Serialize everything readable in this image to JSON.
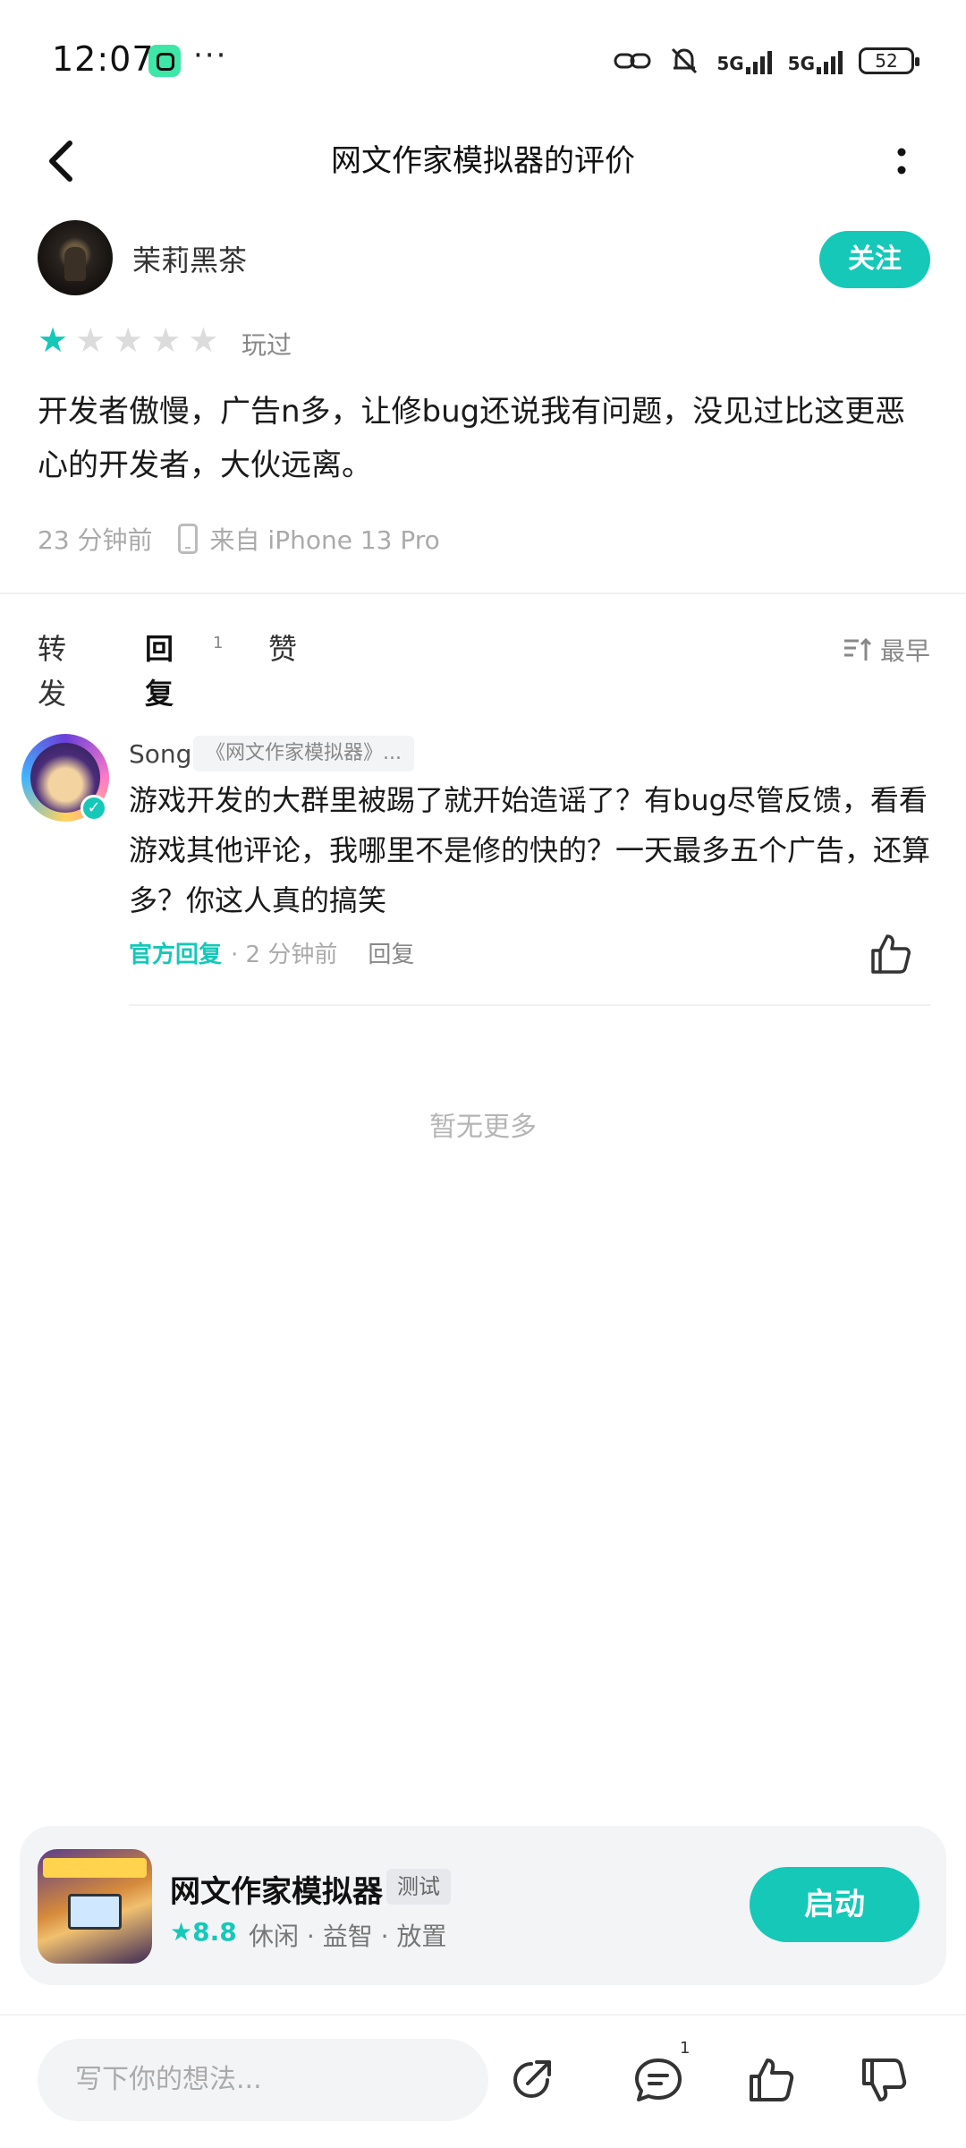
{
  "status_bar": {
    "time": "12:07",
    "dots": "···",
    "net1": "5G",
    "net2": "5G",
    "battery": "52"
  },
  "header": {
    "title": "网文作家模拟器的评价"
  },
  "review": {
    "author": "茉莉黑茶",
    "follow_label": "关注",
    "rating": 1,
    "max_rating": 5,
    "status": "玩过",
    "text": "开发者傲慢，广告n多，让修bug还说我有问题，没见过比这更恶心的开发者，大伙远离。",
    "time": "23 分钟前",
    "device": "来自 iPhone 13 Pro"
  },
  "tabs": {
    "forward": "转发",
    "reply": "回复",
    "reply_count": "1",
    "like": "赞",
    "sort": "最早"
  },
  "reply": {
    "name": "Song",
    "tag": "《网文作家模拟器》...",
    "text": "游戏开发的大群里被踢了就开始造谣了？有bug尽管反馈，看看游戏其他评论，我哪里不是修的快的？一天最多五个广告，还算多？你这人真的搞笑",
    "official": "官方回复",
    "time": "· 2 分钟前",
    "reply_action": "回复"
  },
  "no_more": "暂无更多",
  "game": {
    "title": "网文作家模拟器",
    "tag": "测试",
    "rating": "8.8",
    "categories": "休闲 · 益智 · 放置",
    "launch_label": "启动"
  },
  "bottom_bar": {
    "placeholder": "写下你的想法...",
    "comment_count": "1"
  },
  "colors": {
    "accent": "#15c8b8"
  }
}
